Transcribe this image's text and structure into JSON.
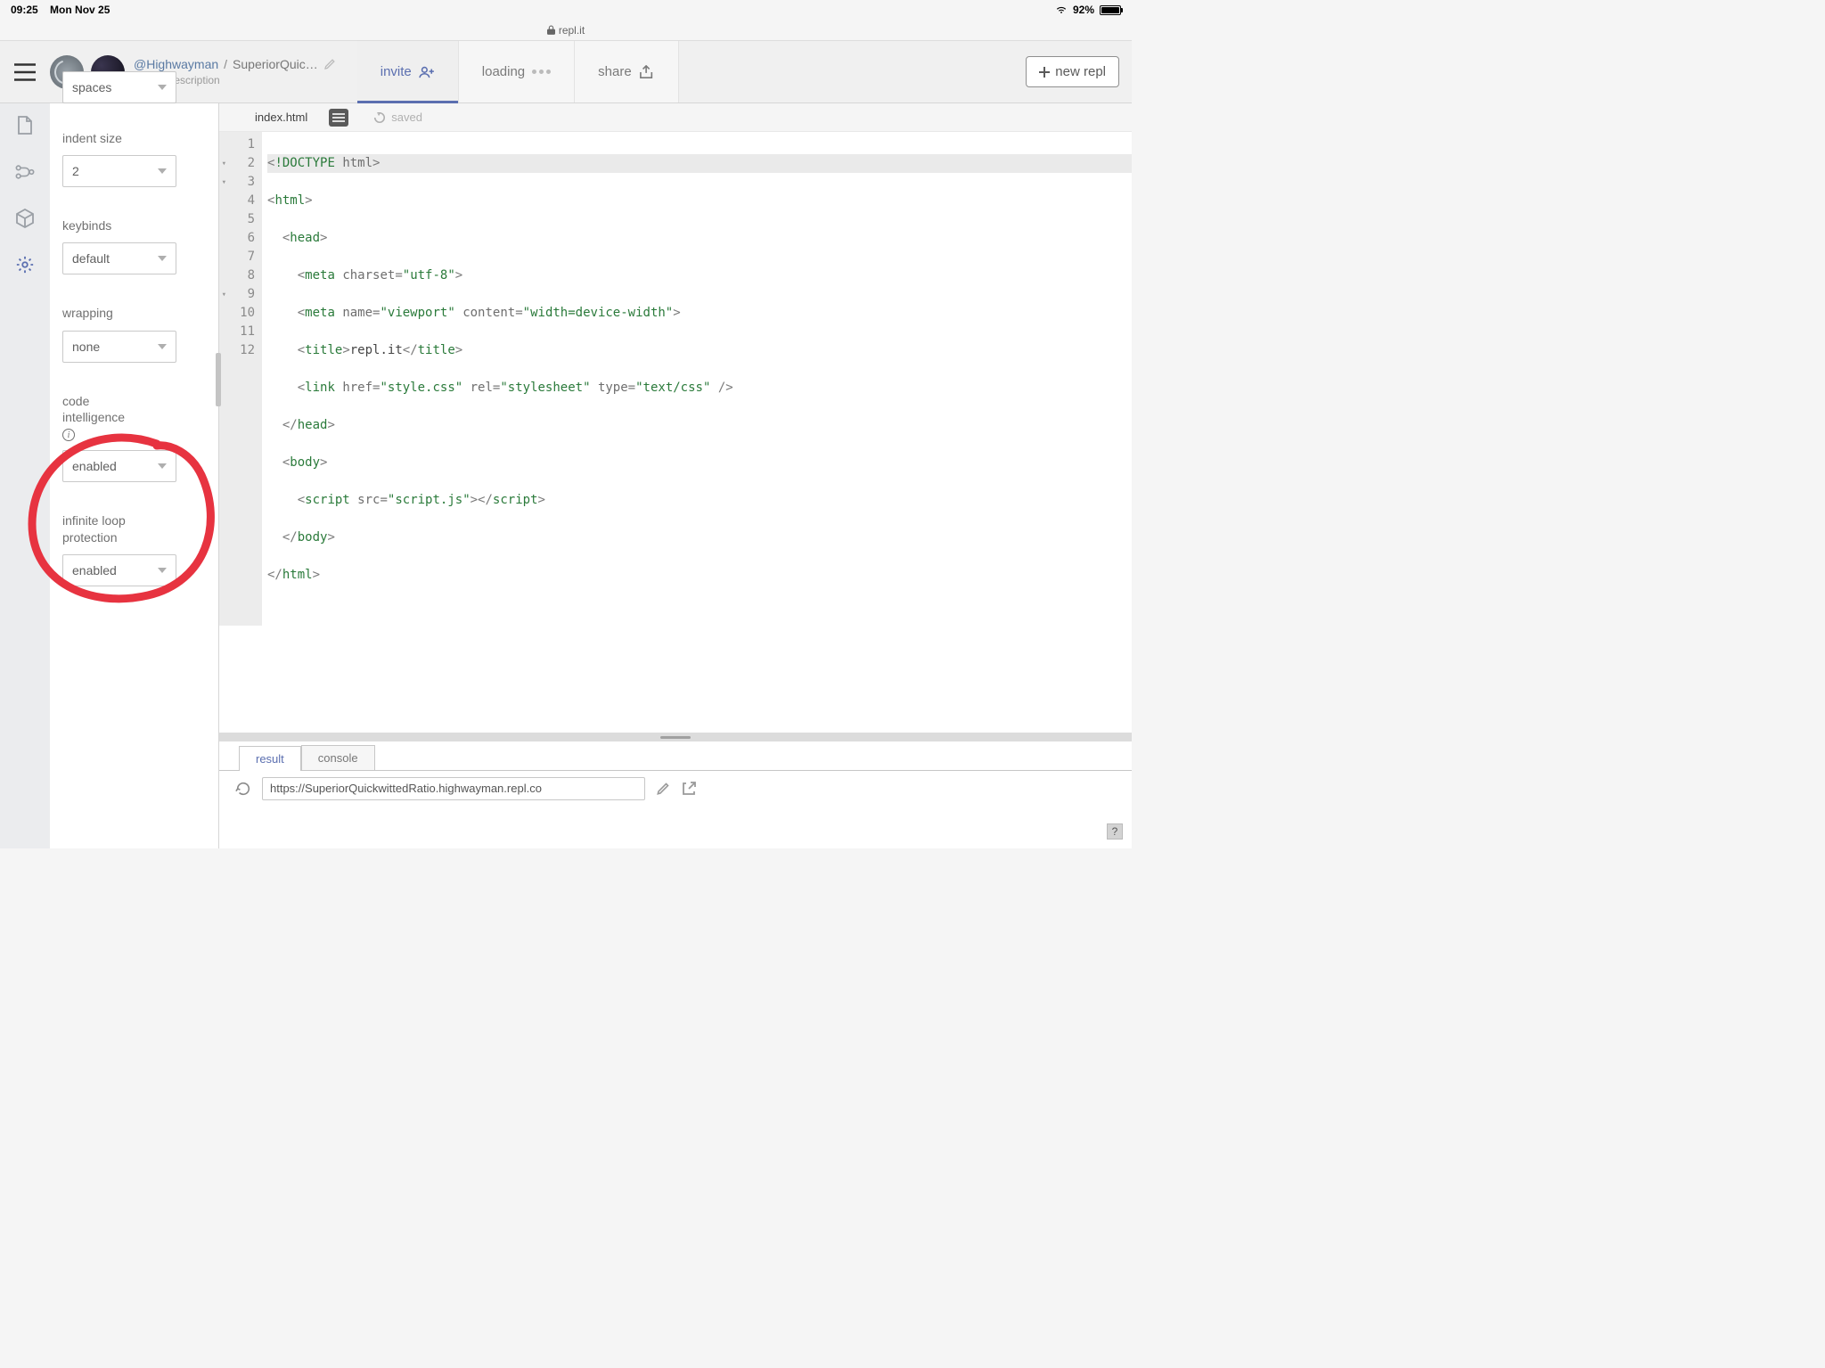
{
  "statusbar": {
    "time": "09:25",
    "date": "Mon Nov 25",
    "battery": "92%"
  },
  "urlbar": {
    "domain": "repl.it"
  },
  "topbar": {
    "user": "@Highwayman",
    "sep": "/",
    "repl_name": "SuperiorQuic…",
    "no_desc": "No description",
    "tabs": {
      "invite": "invite",
      "loading": "loading",
      "share": "share"
    },
    "new_repl": "new repl"
  },
  "settings": {
    "spaces": {
      "label": "spaces"
    },
    "indent": {
      "label": "indent size",
      "value": "2"
    },
    "keybinds": {
      "label": "keybinds",
      "value": "default"
    },
    "wrapping": {
      "label": "wrapping",
      "value": "none"
    },
    "code_intel": {
      "label1": "code",
      "label2": "intelligence",
      "value": "enabled"
    },
    "loop": {
      "label1": "infinite loop",
      "label2": "protection",
      "value": "enabled"
    }
  },
  "editor": {
    "filename": "index.html",
    "saved": "saved",
    "lines": [
      "1",
      "2",
      "3",
      "4",
      "5",
      "6",
      "7",
      "8",
      "9",
      "10",
      "11",
      "12"
    ]
  },
  "output": {
    "tabs": {
      "result": "result",
      "console": "console"
    },
    "url": "https://SuperiorQuickwittedRatio.highwayman.repl.co"
  },
  "help": "?"
}
